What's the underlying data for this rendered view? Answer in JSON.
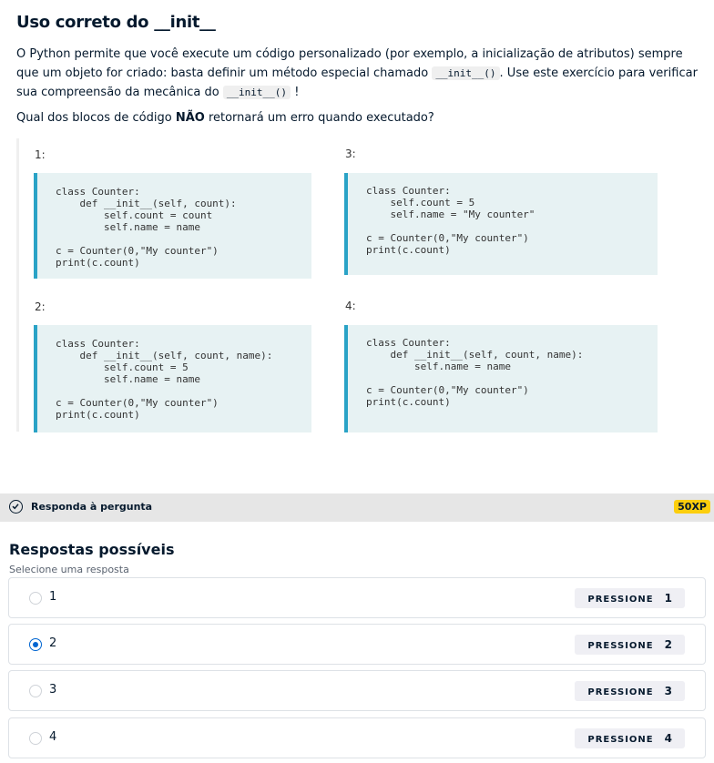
{
  "exercise": {
    "title": "Uso correto do __init__",
    "intro_part1": "O Python permite que você execute um código personalizado (por exemplo, a inicialização de atributos) sempre que um objeto for criado: basta definir um método especial chamado ",
    "intro_code1": "__init__()",
    "intro_part2": ". Use este exercício para verificar sua compreensão da mecânica do ",
    "intro_code2": "__init__()",
    "intro_part3": "!",
    "question_before": "Qual dos blocos de código ",
    "question_bold": "NÃO",
    "question_after": " retornará um erro quando executado?",
    "options": [
      {
        "number": "1:",
        "code": "class Counter:\n    def __init__(self, count):\n        self.count = count\n        self.name = name\n\nc = Counter(0,\"My counter\")\nprint(c.count)"
      },
      {
        "number": "2:",
        "code": "class Counter:\n    def __init__(self, count, name):\n        self.count = 5\n        self.name = name\n\nc = Counter(0,\"My counter\")\nprint(c.count)"
      },
      {
        "number": "3:",
        "code": "class Counter:\n    self.count = 5\n    self.name = \"My counter\"\n\nc = Counter(0,\"My counter\")\nprint(c.count)"
      },
      {
        "number": "4:",
        "code": "class Counter:\n    def __init__(self, count, name):\n        self.name = name\n\nc = Counter(0,\"My counter\")\nprint(c.count)"
      }
    ]
  },
  "answer_bar": {
    "label": "Responda à pergunta",
    "xp": "50XP"
  },
  "responses": {
    "title": "Respostas possíveis",
    "subtitle": "Selecione uma resposta",
    "choices": [
      {
        "label": "1",
        "key_text": "PRESSIONE",
        "key": "1",
        "selected": false
      },
      {
        "label": "2",
        "key_text": "PRESSIONE",
        "key": "2",
        "selected": true
      },
      {
        "label": "3",
        "key_text": "PRESSIONE",
        "key": "3",
        "selected": false
      },
      {
        "label": "4",
        "key_text": "PRESSIONE",
        "key": "4",
        "selected": false
      }
    ]
  },
  "colors": {
    "accent": "#2aa3c6",
    "code_bg": "#e7f2f3",
    "xp_badge": "#fcce0d",
    "radio_selected": "#0065d1"
  }
}
